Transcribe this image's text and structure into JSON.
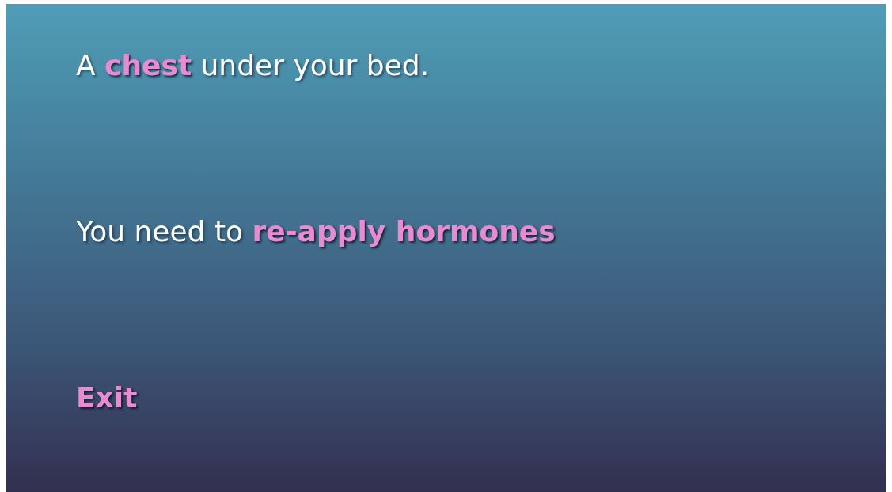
{
  "passages": [
    {
      "segments": [
        {
          "kind": "text",
          "text": "A "
        },
        {
          "kind": "link",
          "text": "chest"
        },
        {
          "kind": "text",
          "text": " under your bed."
        }
      ]
    },
    {
      "segments": [
        {
          "kind": "text",
          "text": "You need to "
        },
        {
          "kind": "link",
          "text": "re-apply hormones"
        }
      ]
    },
    {
      "segments": [
        {
          "kind": "link",
          "text": "Exit"
        }
      ]
    }
  ]
}
